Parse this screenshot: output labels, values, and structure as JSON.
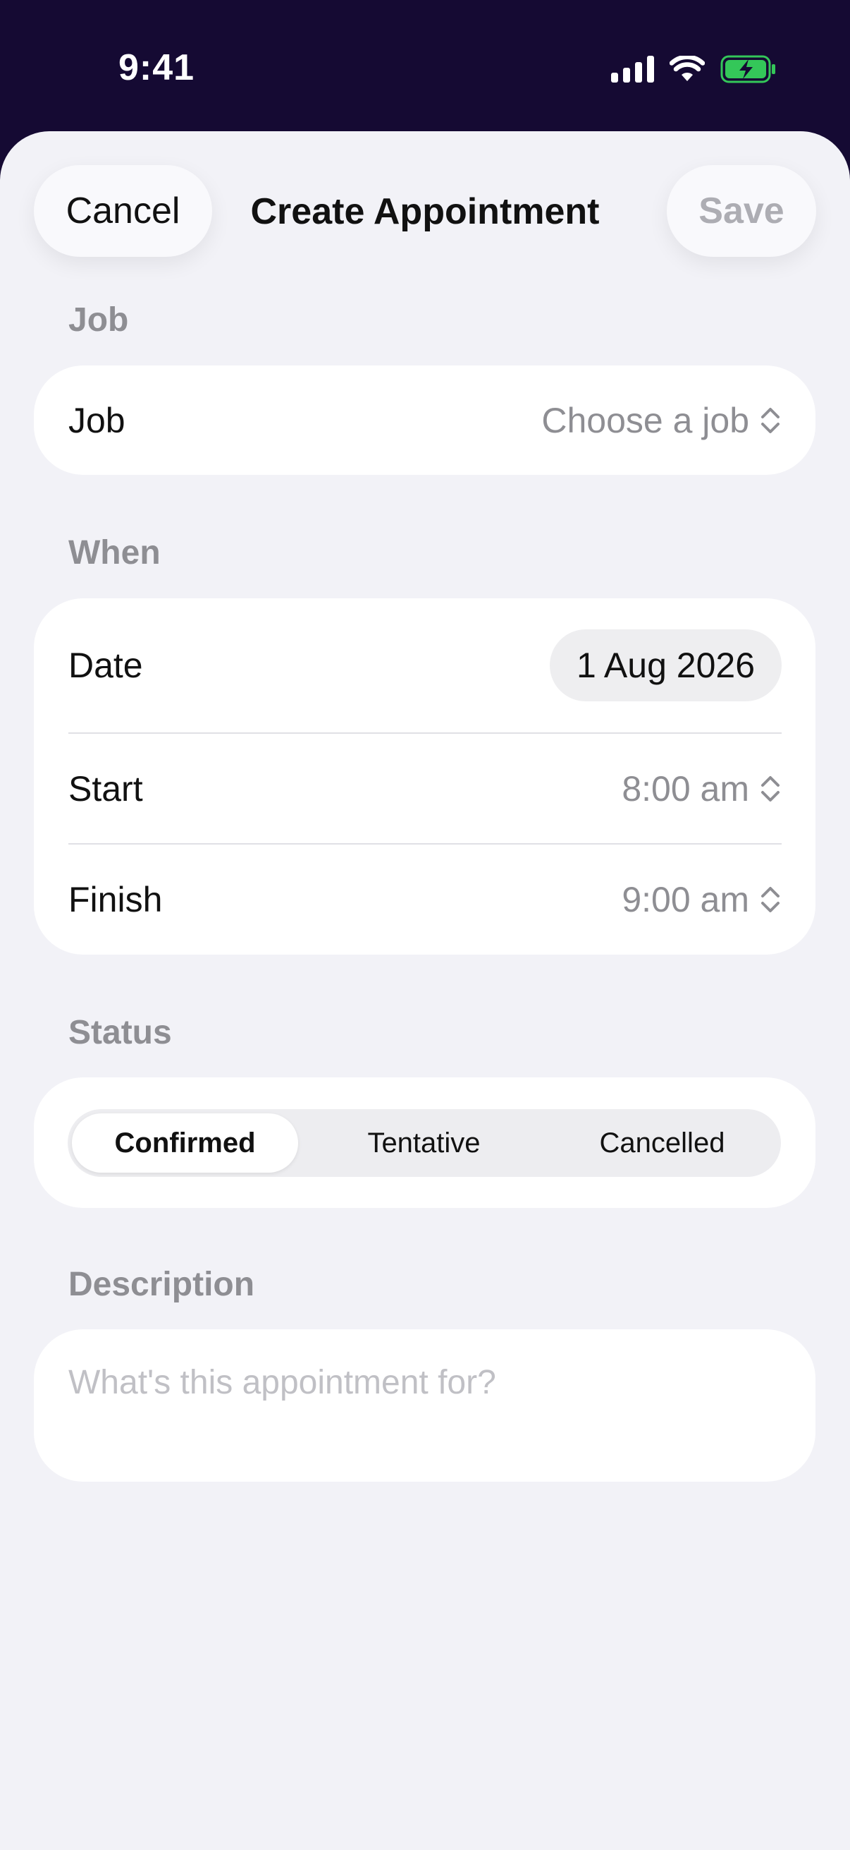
{
  "status_bar": {
    "time": "9:41"
  },
  "header": {
    "cancel_label": "Cancel",
    "title": "Create Appointment",
    "save_label": "Save"
  },
  "job_section": {
    "label": "Job",
    "row_label": "Job",
    "row_value": "Choose a job"
  },
  "when_section": {
    "label": "When",
    "date_label": "Date",
    "date_value": "1 Aug 2026",
    "start_label": "Start",
    "start_value": "8:00 am",
    "finish_label": "Finish",
    "finish_value": "9:00 am"
  },
  "status_section": {
    "label": "Status",
    "options": [
      "Confirmed",
      "Tentative",
      "Cancelled"
    ],
    "selected": "Confirmed"
  },
  "description_section": {
    "label": "Description",
    "placeholder": "What's this appointment for?"
  },
  "colors": {
    "header_bg": "#150a33",
    "sheet_bg": "#f2f2f7",
    "battery_charging": "#34c759"
  }
}
